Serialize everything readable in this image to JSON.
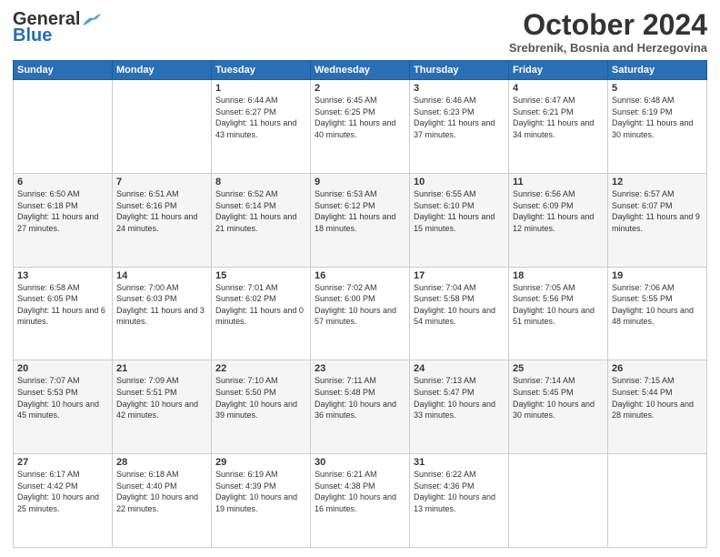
{
  "logo": {
    "line1": "General",
    "line2": "Blue"
  },
  "header": {
    "month": "October 2024",
    "location": "Srebrenik, Bosnia and Herzegovina"
  },
  "days_of_week": [
    "Sunday",
    "Monday",
    "Tuesday",
    "Wednesday",
    "Thursday",
    "Friday",
    "Saturday"
  ],
  "weeks": [
    [
      {
        "day": "",
        "sunrise": "",
        "sunset": "",
        "daylight": ""
      },
      {
        "day": "",
        "sunrise": "",
        "sunset": "",
        "daylight": ""
      },
      {
        "day": "1",
        "sunrise": "Sunrise: 6:44 AM",
        "sunset": "Sunset: 6:27 PM",
        "daylight": "Daylight: 11 hours and 43 minutes."
      },
      {
        "day": "2",
        "sunrise": "Sunrise: 6:45 AM",
        "sunset": "Sunset: 6:25 PM",
        "daylight": "Daylight: 11 hours and 40 minutes."
      },
      {
        "day": "3",
        "sunrise": "Sunrise: 6:46 AM",
        "sunset": "Sunset: 6:23 PM",
        "daylight": "Daylight: 11 hours and 37 minutes."
      },
      {
        "day": "4",
        "sunrise": "Sunrise: 6:47 AM",
        "sunset": "Sunset: 6:21 PM",
        "daylight": "Daylight: 11 hours and 34 minutes."
      },
      {
        "day": "5",
        "sunrise": "Sunrise: 6:48 AM",
        "sunset": "Sunset: 6:19 PM",
        "daylight": "Daylight: 11 hours and 30 minutes."
      }
    ],
    [
      {
        "day": "6",
        "sunrise": "Sunrise: 6:50 AM",
        "sunset": "Sunset: 6:18 PM",
        "daylight": "Daylight: 11 hours and 27 minutes."
      },
      {
        "day": "7",
        "sunrise": "Sunrise: 6:51 AM",
        "sunset": "Sunset: 6:16 PM",
        "daylight": "Daylight: 11 hours and 24 minutes."
      },
      {
        "day": "8",
        "sunrise": "Sunrise: 6:52 AM",
        "sunset": "Sunset: 6:14 PM",
        "daylight": "Daylight: 11 hours and 21 minutes."
      },
      {
        "day": "9",
        "sunrise": "Sunrise: 6:53 AM",
        "sunset": "Sunset: 6:12 PM",
        "daylight": "Daylight: 11 hours and 18 minutes."
      },
      {
        "day": "10",
        "sunrise": "Sunrise: 6:55 AM",
        "sunset": "Sunset: 6:10 PM",
        "daylight": "Daylight: 11 hours and 15 minutes."
      },
      {
        "day": "11",
        "sunrise": "Sunrise: 6:56 AM",
        "sunset": "Sunset: 6:09 PM",
        "daylight": "Daylight: 11 hours and 12 minutes."
      },
      {
        "day": "12",
        "sunrise": "Sunrise: 6:57 AM",
        "sunset": "Sunset: 6:07 PM",
        "daylight": "Daylight: 11 hours and 9 minutes."
      }
    ],
    [
      {
        "day": "13",
        "sunrise": "Sunrise: 6:58 AM",
        "sunset": "Sunset: 6:05 PM",
        "daylight": "Daylight: 11 hours and 6 minutes."
      },
      {
        "day": "14",
        "sunrise": "Sunrise: 7:00 AM",
        "sunset": "Sunset: 6:03 PM",
        "daylight": "Daylight: 11 hours and 3 minutes."
      },
      {
        "day": "15",
        "sunrise": "Sunrise: 7:01 AM",
        "sunset": "Sunset: 6:02 PM",
        "daylight": "Daylight: 11 hours and 0 minutes."
      },
      {
        "day": "16",
        "sunrise": "Sunrise: 7:02 AM",
        "sunset": "Sunset: 6:00 PM",
        "daylight": "Daylight: 10 hours and 57 minutes."
      },
      {
        "day": "17",
        "sunrise": "Sunrise: 7:04 AM",
        "sunset": "Sunset: 5:58 PM",
        "daylight": "Daylight: 10 hours and 54 minutes."
      },
      {
        "day": "18",
        "sunrise": "Sunrise: 7:05 AM",
        "sunset": "Sunset: 5:56 PM",
        "daylight": "Daylight: 10 hours and 51 minutes."
      },
      {
        "day": "19",
        "sunrise": "Sunrise: 7:06 AM",
        "sunset": "Sunset: 5:55 PM",
        "daylight": "Daylight: 10 hours and 48 minutes."
      }
    ],
    [
      {
        "day": "20",
        "sunrise": "Sunrise: 7:07 AM",
        "sunset": "Sunset: 5:53 PM",
        "daylight": "Daylight: 10 hours and 45 minutes."
      },
      {
        "day": "21",
        "sunrise": "Sunrise: 7:09 AM",
        "sunset": "Sunset: 5:51 PM",
        "daylight": "Daylight: 10 hours and 42 minutes."
      },
      {
        "day": "22",
        "sunrise": "Sunrise: 7:10 AM",
        "sunset": "Sunset: 5:50 PM",
        "daylight": "Daylight: 10 hours and 39 minutes."
      },
      {
        "day": "23",
        "sunrise": "Sunrise: 7:11 AM",
        "sunset": "Sunset: 5:48 PM",
        "daylight": "Daylight: 10 hours and 36 minutes."
      },
      {
        "day": "24",
        "sunrise": "Sunrise: 7:13 AM",
        "sunset": "Sunset: 5:47 PM",
        "daylight": "Daylight: 10 hours and 33 minutes."
      },
      {
        "day": "25",
        "sunrise": "Sunrise: 7:14 AM",
        "sunset": "Sunset: 5:45 PM",
        "daylight": "Daylight: 10 hours and 30 minutes."
      },
      {
        "day": "26",
        "sunrise": "Sunrise: 7:15 AM",
        "sunset": "Sunset: 5:44 PM",
        "daylight": "Daylight: 10 hours and 28 minutes."
      }
    ],
    [
      {
        "day": "27",
        "sunrise": "Sunrise: 6:17 AM",
        "sunset": "Sunset: 4:42 PM",
        "daylight": "Daylight: 10 hours and 25 minutes."
      },
      {
        "day": "28",
        "sunrise": "Sunrise: 6:18 AM",
        "sunset": "Sunset: 4:40 PM",
        "daylight": "Daylight: 10 hours and 22 minutes."
      },
      {
        "day": "29",
        "sunrise": "Sunrise: 6:19 AM",
        "sunset": "Sunset: 4:39 PM",
        "daylight": "Daylight: 10 hours and 19 minutes."
      },
      {
        "day": "30",
        "sunrise": "Sunrise: 6:21 AM",
        "sunset": "Sunset: 4:38 PM",
        "daylight": "Daylight: 10 hours and 16 minutes."
      },
      {
        "day": "31",
        "sunrise": "Sunrise: 6:22 AM",
        "sunset": "Sunset: 4:36 PM",
        "daylight": "Daylight: 10 hours and 13 minutes."
      },
      {
        "day": "",
        "sunrise": "",
        "sunset": "",
        "daylight": ""
      },
      {
        "day": "",
        "sunrise": "",
        "sunset": "",
        "daylight": ""
      }
    ]
  ]
}
